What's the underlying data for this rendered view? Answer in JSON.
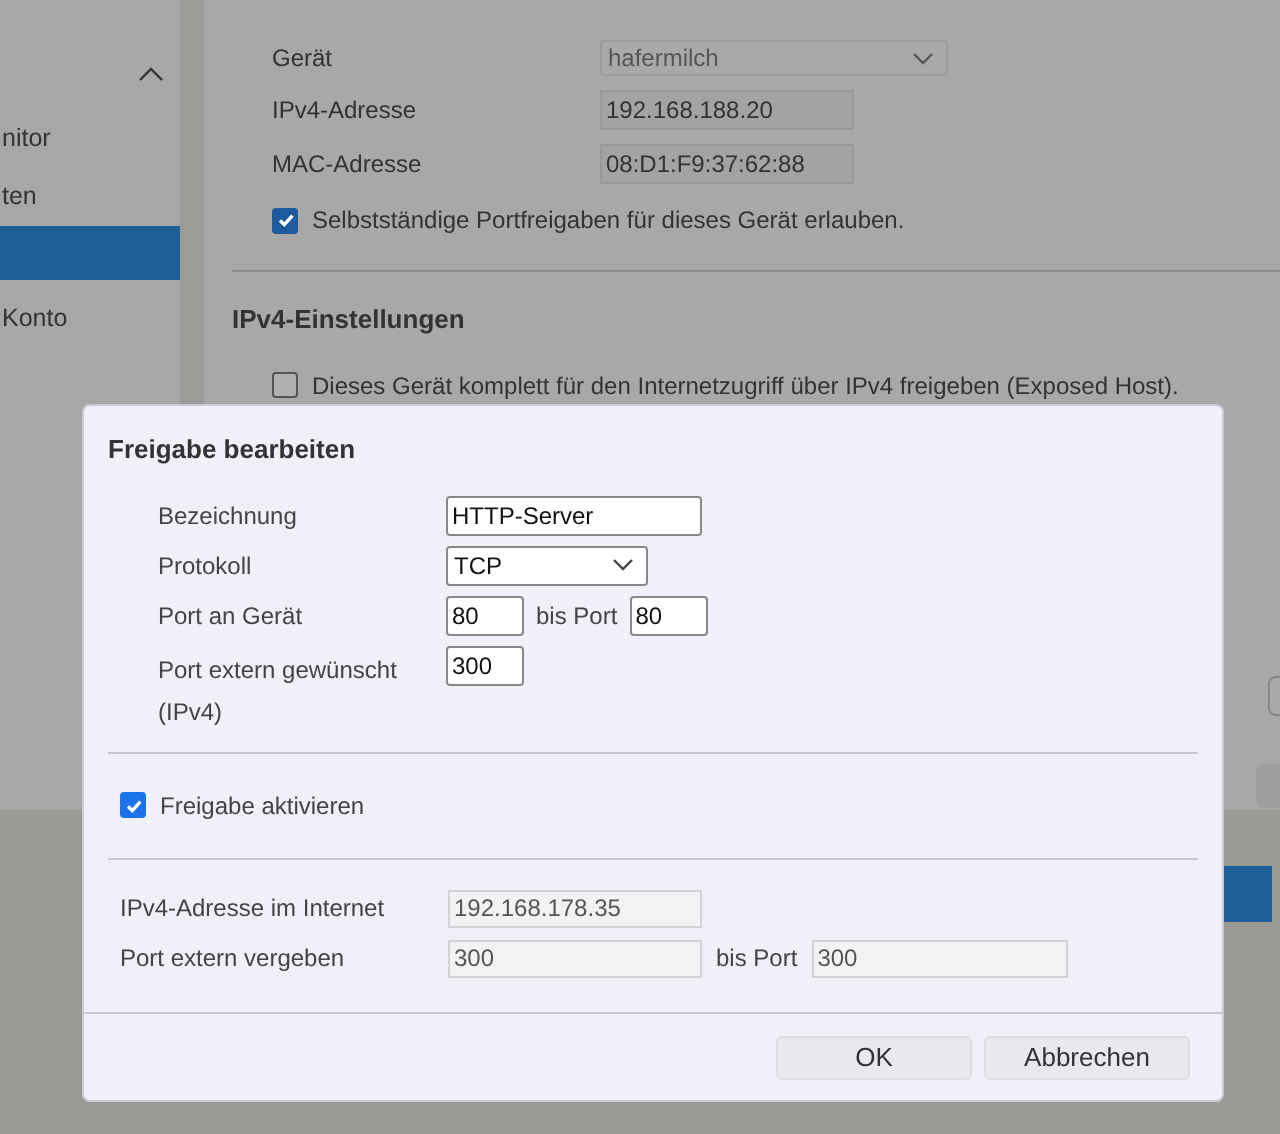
{
  "sidebar": {
    "expanded": true,
    "items": [
      {
        "label": "nitor",
        "selected": false
      },
      {
        "label": "ten",
        "selected": false
      },
      {
        "selected": true
      },
      {
        "label": "Konto",
        "selected": false
      }
    ]
  },
  "device": {
    "fields": [
      {
        "kind": "select",
        "label": "Gerät",
        "value": "hafermilch"
      },
      {
        "kind": "text",
        "label": "IPv4-Adresse",
        "value": "192.168.188.20"
      },
      {
        "kind": "text",
        "label": "MAC-Adresse",
        "value": "08:D1:F9:37:62:88"
      }
    ],
    "allow": {
      "label": "Selbstständige Portfreigaben für dieses Gerät erlauben.",
      "checked": true
    }
  },
  "ipv4": {
    "title": "IPv4-Einstellungen",
    "exposed_host": {
      "label": "Dieses Gerät komplett für den Internetzugriff über IPv4 freigeben (Exposed Host).",
      "checked": false
    }
  },
  "dialog": {
    "title": "Freigabe bearbeiten",
    "fields": [
      {
        "kind": "text",
        "label": "Bezeichnung",
        "value": "HTTP-Server"
      },
      {
        "kind": "select",
        "label": "Protokoll",
        "value": "TCP"
      },
      {
        "kind": "range",
        "label": "Port an Gerät",
        "value": "80",
        "to_label": "bis Port",
        "to_value": "80"
      },
      {
        "kind": "port",
        "label": "Port extern gewünscht (IPv4)",
        "value": "300"
      }
    ],
    "activate": {
      "label": "Freigabe aktivieren",
      "checked": true
    },
    "info": [
      {
        "label": "IPv4-Adresse im Internet",
        "value": "192.168.178.35"
      },
      {
        "label": "Port extern vergeben",
        "value": "300",
        "to_label": "bis Port",
        "to_value": "300"
      }
    ],
    "buttons": [
      "OK",
      "Abbrechen"
    ]
  }
}
